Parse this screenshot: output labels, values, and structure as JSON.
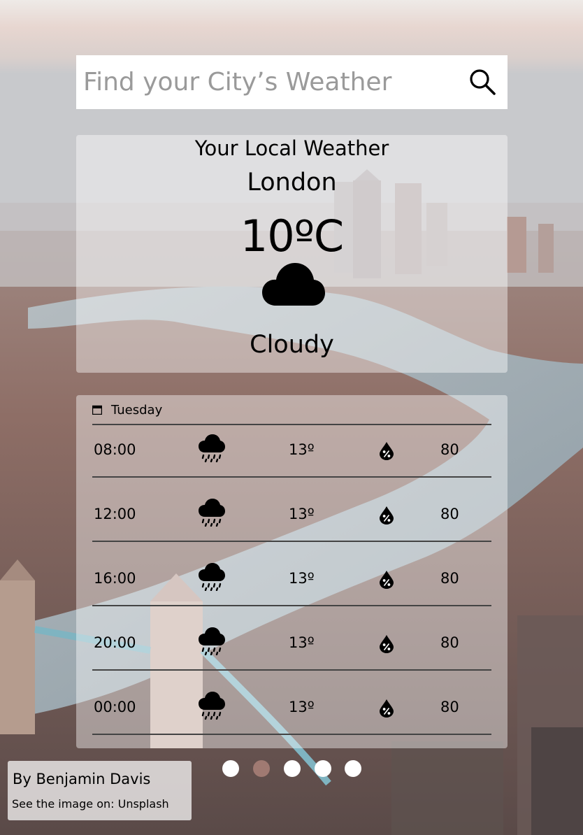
{
  "search": {
    "placeholder": "Find your City’s Weather",
    "icon": "search-icon"
  },
  "current": {
    "heading": "Your Local Weather",
    "city": "London",
    "temperature": "10ºC",
    "condition_icon": "cloud-icon",
    "condition": "Cloudy"
  },
  "forecast": {
    "day_icon": "calendar-icon",
    "day": "Tuesday",
    "rows": [
      {
        "time": "08:00",
        "icon": "rain-cloud-icon",
        "temp": "13º",
        "humidity_icon": "humidity-drop-icon",
        "humidity": "80"
      },
      {
        "time": "12:00",
        "icon": "rain-cloud-icon",
        "temp": "13º",
        "humidity_icon": "humidity-drop-icon",
        "humidity": "80"
      },
      {
        "time": "16:00",
        "icon": "rain-cloud-icon",
        "temp": "13º",
        "humidity_icon": "humidity-drop-icon",
        "humidity": "80"
      },
      {
        "time": "20:00",
        "icon": "rain-cloud-icon",
        "temp": "13º",
        "humidity_icon": "humidity-drop-icon",
        "humidity": "80"
      },
      {
        "time": "00:00",
        "icon": "rain-cloud-icon",
        "temp": "13º",
        "humidity_icon": "humidity-drop-icon",
        "humidity": "80"
      }
    ]
  },
  "pagination": {
    "count": 5,
    "active_index": 1,
    "color_active": "#a07a72",
    "color_inactive": "#ffffff"
  },
  "credit": {
    "author": "By Benjamin Davis",
    "source_prefix": "See the image on: ",
    "source_link": "Unsplash"
  }
}
